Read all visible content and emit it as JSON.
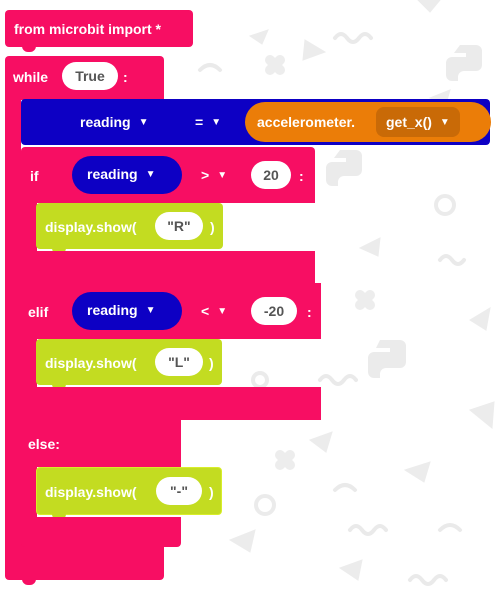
{
  "program": {
    "import_line": "from microbit import *",
    "while_kw": "while",
    "while_cond": "True",
    "while_colon": ":",
    "assign": {
      "variable": "reading",
      "operator": "=",
      "module": "accelerometer.",
      "method": "get_x()"
    },
    "if_block": {
      "keyword": "if",
      "variable": "reading",
      "operator": ">",
      "value": "20",
      "colon": ":",
      "call": "display.show(",
      "arg": "\"R\"",
      "close": ")"
    },
    "elif_block": {
      "keyword": "elif",
      "variable": "reading",
      "operator": "<",
      "value": "-20",
      "colon": ":",
      "call": "display.show(",
      "arg": "\"L\"",
      "close": ")"
    },
    "else_block": {
      "keyword": "else:",
      "call": "display.show(",
      "arg": "\"-\"",
      "close": ")"
    }
  },
  "colors": {
    "control_pink": "#f70e63",
    "display_lime": "#c3dc21",
    "variable_navy": "#0d00c4",
    "accelerometer_orange": "#eb7d08"
  },
  "icons": [
    "caret-down-icon",
    "python-logo-pattern",
    "gear-pattern",
    "swirl-pattern"
  ]
}
